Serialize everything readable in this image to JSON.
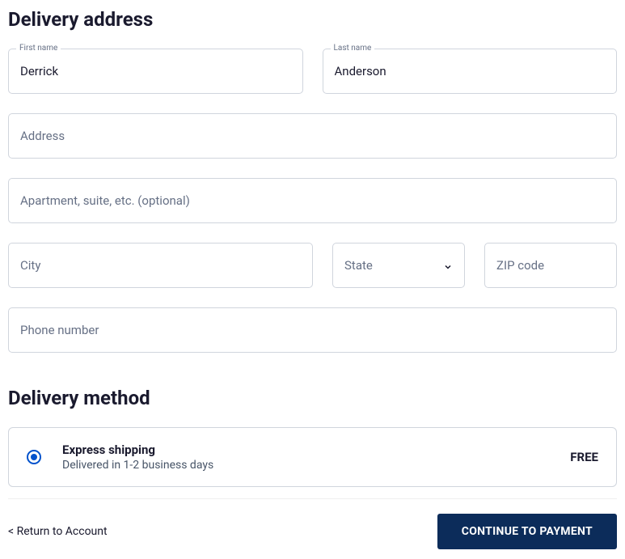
{
  "address_section": {
    "heading": "Delivery address",
    "first_name_label": "First name",
    "first_name_value": "Derrick",
    "last_name_label": "Last name",
    "last_name_value": "Anderson",
    "address_placeholder": "Address",
    "address_value": "",
    "apt_placeholder": "Apartment, suite, etc. (optional)",
    "apt_value": "",
    "city_placeholder": "City",
    "city_value": "",
    "state_placeholder": "State",
    "zip_placeholder": "ZIP code",
    "zip_value": "",
    "phone_placeholder": "Phone number",
    "phone_value": ""
  },
  "method_section": {
    "heading": "Delivery method",
    "option_title": "Express shipping",
    "option_sub": "Delivered in 1-2 business days",
    "option_price": "FREE"
  },
  "footer": {
    "back_text": "< Return to Account",
    "continue_text": "CONTINUE TO PAYMENT"
  }
}
